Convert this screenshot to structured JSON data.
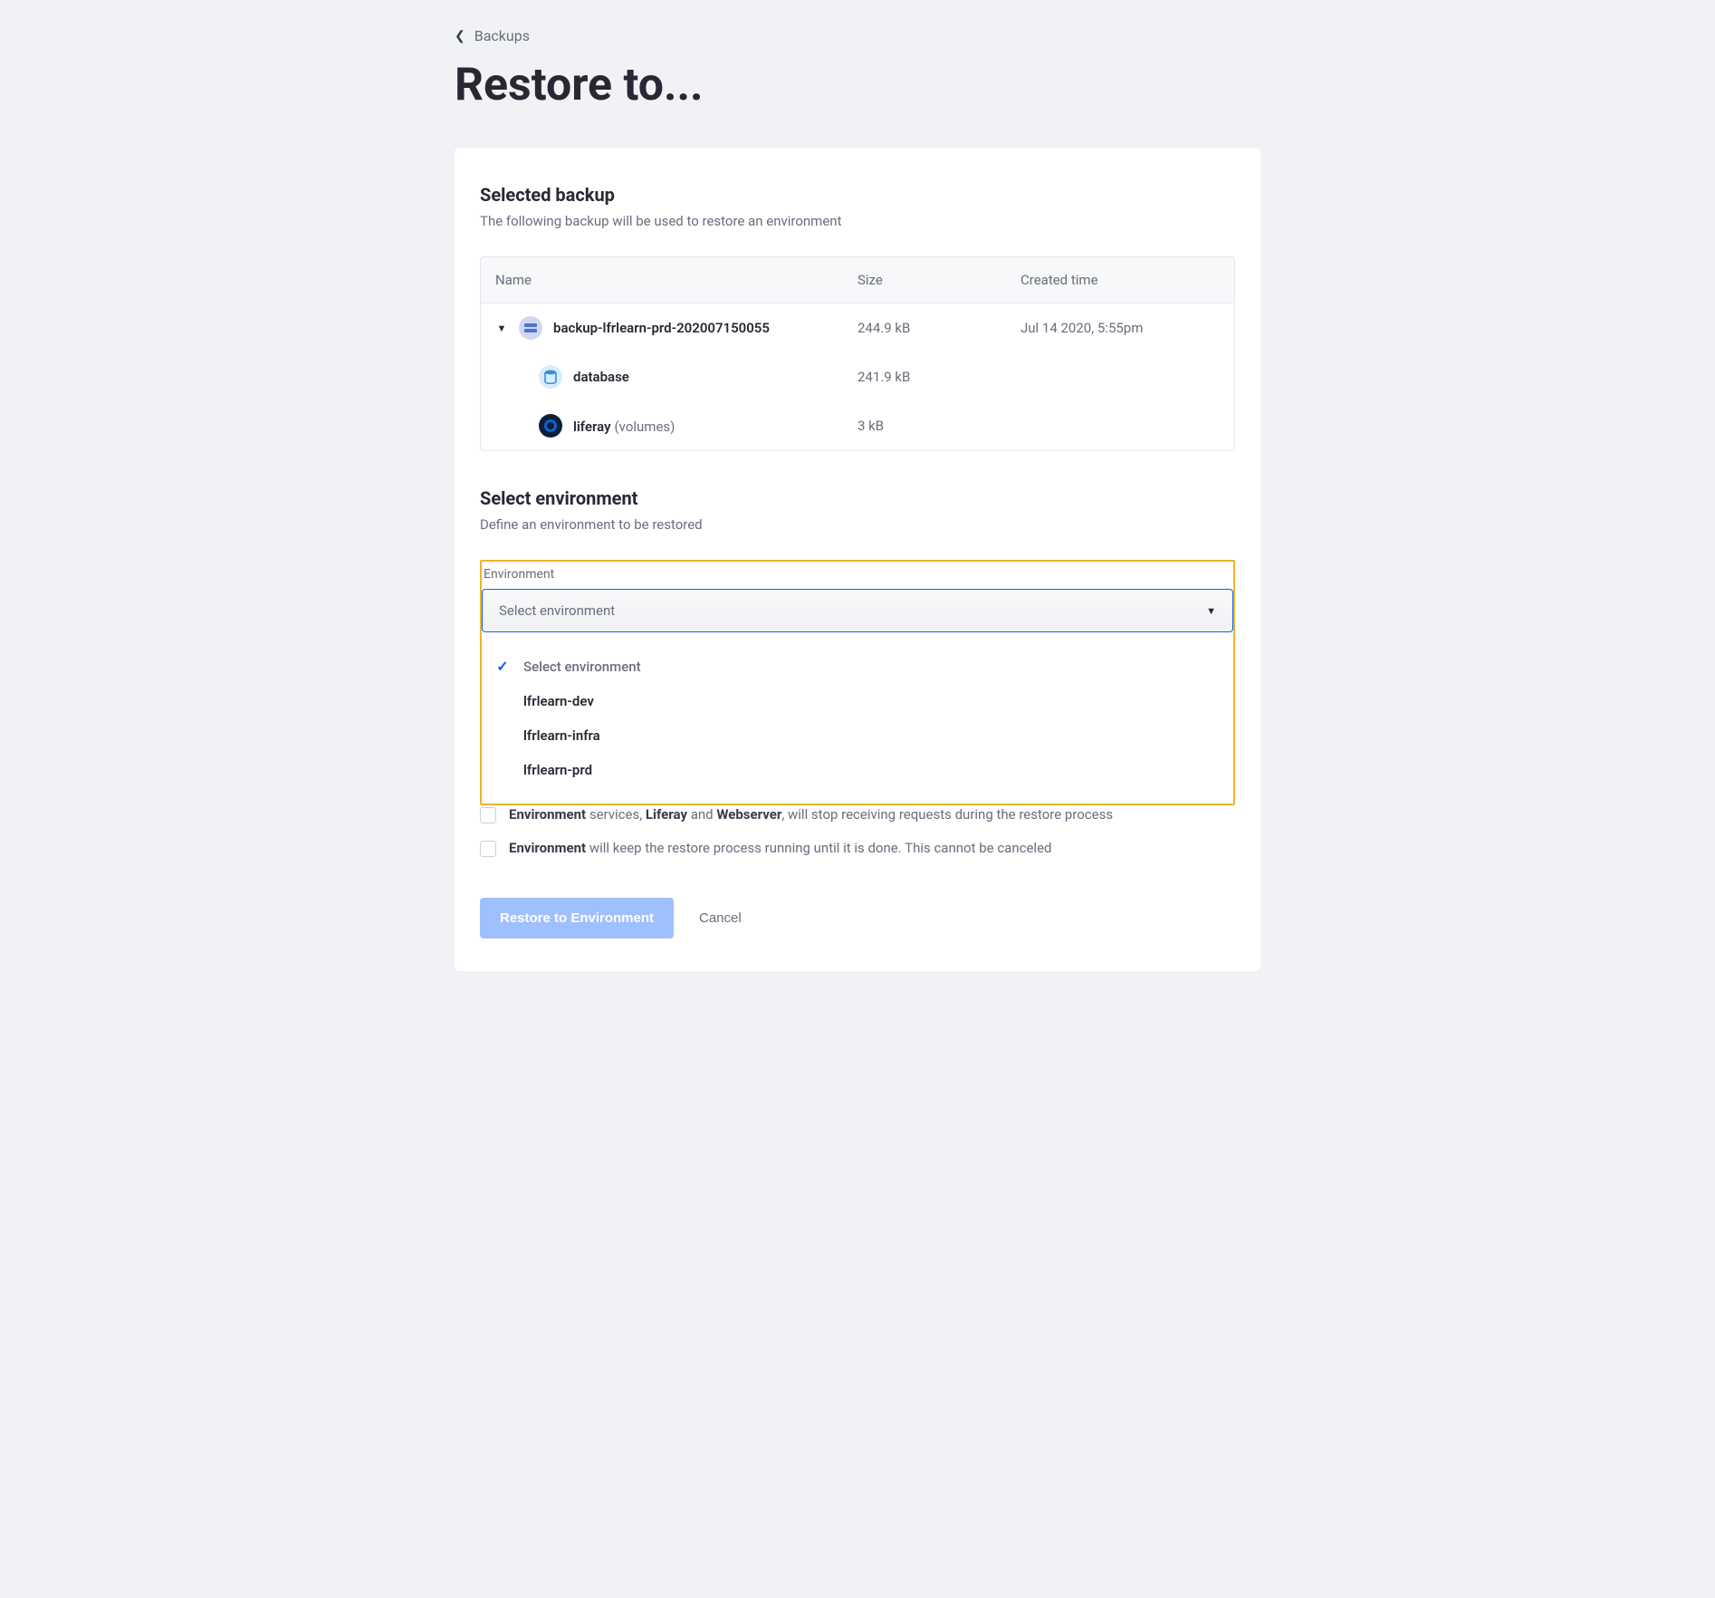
{
  "breadcrumb": {
    "label": "Backups"
  },
  "page_title": "Restore to...",
  "selected_backup": {
    "heading": "Selected backup",
    "sub": "The following backup will be used to restore an environment",
    "columns": {
      "name": "Name",
      "size": "Size",
      "created": "Created time"
    },
    "rows": [
      {
        "name": "backup-lfrlearn-prd-202007150055",
        "size": "244.9 kB",
        "created": "Jul 14 2020, 5:55pm",
        "icon": "backup-icon"
      },
      {
        "name": "database",
        "suffix": "",
        "size": "241.9 kB",
        "created": "",
        "icon": "database-icon",
        "indent": true
      },
      {
        "name": "liferay",
        "suffix": "(volumes)",
        "size": "3 kB",
        "created": "",
        "icon": "liferay-icon",
        "indent": true
      }
    ]
  },
  "select_env": {
    "heading": "Select environment",
    "sub": "Define an environment to be restored",
    "label": "Environment",
    "placeholder": "Select environment",
    "options": [
      {
        "label": "Select environment",
        "selected": true
      },
      {
        "label": "lfrlearn-dev",
        "selected": false
      },
      {
        "label": "lfrlearn-infra",
        "selected": false
      },
      {
        "label": "lfrlearn-prd",
        "selected": false
      }
    ]
  },
  "checklist": {
    "row1_pre": "Environment",
    "row1_mid1": " services, ",
    "row1_b1": "Liferay",
    "row1_mid2": " and ",
    "row1_b2": "Webserver",
    "row1_post": ", will stop receiving requests during the restore process",
    "row2_pre": "Environment",
    "row2_post": " will keep the restore process running until it is done. This cannot be canceled"
  },
  "actions": {
    "primary": "Restore to Environment",
    "cancel": "Cancel"
  }
}
